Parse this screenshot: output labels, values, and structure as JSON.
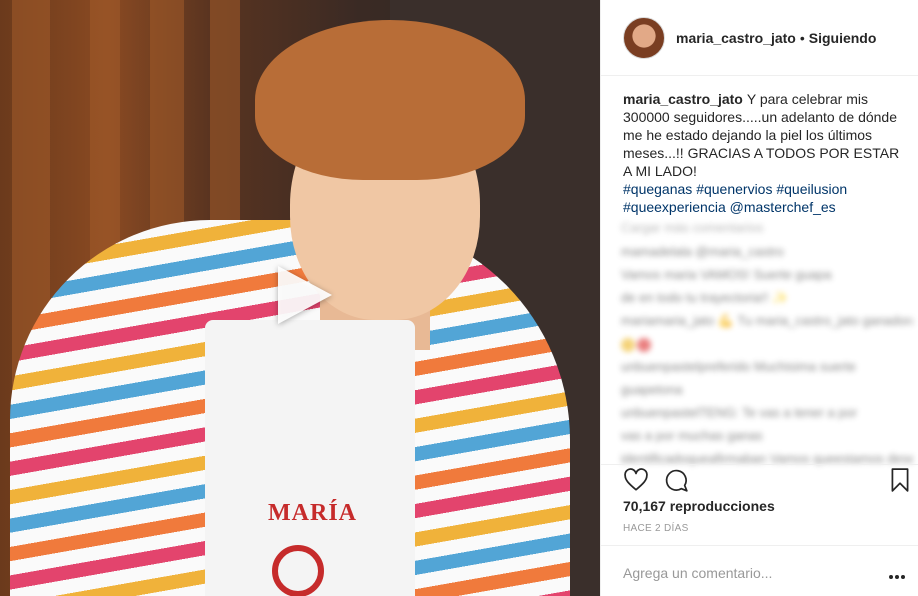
{
  "post": {
    "header": {
      "username": "maria_castro_jato",
      "separator": "•",
      "follow_status": "Siguiendo"
    },
    "caption": {
      "username": "maria_castro_jato",
      "text": "Y para celebrar mis 300000 seguidores.....un adelanto de dónde me he estado dejando la piel los últimos meses...!! GRACIAS A TODOS POR ESTAR A MI LADO!",
      "hashtags": [
        "#queganas",
        "#quenervios",
        "#queilusion",
        "#queexperiencia",
        "@masterchef_es"
      ]
    },
    "media": {
      "type": "video",
      "apron_name": "MARÍA",
      "play_icon": "play-icon"
    },
    "stats": {
      "views": "70,167 reproducciones",
      "time_ago": "HACE 2 DÍAS"
    },
    "comment_input": {
      "placeholder": "Agrega un comentario..."
    },
    "blurred_comments": {
      "load_more": "Cargar más comentarios",
      "rows": [
        "mamadelala @maria_castro",
        "Vamos maria VAMOS! Suerte guapa",
        "de en todo tu trayectoria!! ✨",
        "mariamaria_jato 💪 Tu maria_castro_jato ganadora",
        "",
        "unbuenpastelpreferido Muchisima suerte",
        "guapetona",
        "unbuenpastelTENG: Te vas a tener a por",
        "vas a por muchas ganas",
        "identificadoqueafirmaban Vamos queestamos deseandose"
      ]
    },
    "colors": {
      "link": "#003569",
      "muted": "#999999",
      "text": "#262626"
    },
    "icons": [
      "heart-icon",
      "comment-icon",
      "bookmark-icon",
      "more-icon"
    ]
  }
}
